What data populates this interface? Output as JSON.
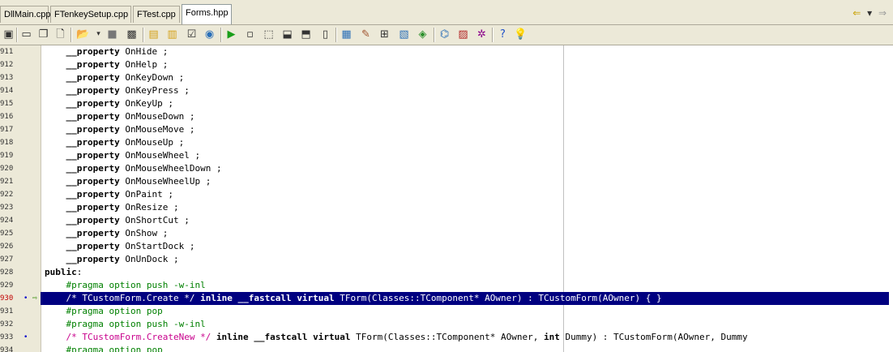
{
  "tabs": [
    {
      "label": "DllMain.cpp",
      "active": false
    },
    {
      "label": "FTenkeySetup.cpp",
      "active": false
    },
    {
      "label": "FTest.cpp",
      "active": false
    },
    {
      "label": "Forms.hpp",
      "active": true
    }
  ],
  "nav": {
    "back_icon": "back-arrow-icon",
    "dropdown_icon": "dropdown-arrow-icon",
    "forward_icon": "forward-arrow-icon"
  },
  "toolbar_icons": [
    "layout-icon",
    "window-icon",
    "copy-window-icon",
    "new-file-icon",
    "open-file-icon",
    "open-dropdown-icon",
    "save-icon",
    "save-all-icon",
    "add-to-project-icon",
    "open-project-icon",
    "remove-from-project-icon",
    "toggle-form-unit-icon",
    "new-form-icon",
    "run-icon",
    "pause-icon",
    "trace-into-icon",
    "step-over-icon",
    "run-to-cursor-icon",
    "program-reset-icon",
    "component-icon",
    "edit-icon",
    "package-icon",
    "object-inspector-icon",
    "database-icon",
    "remote-icon",
    "debug-windows-icon",
    "cpu-icon",
    "help-icon",
    "tip-icon"
  ],
  "colors": {
    "highlight": "#000080",
    "keyword": "#000000",
    "directive": "#008000",
    "comment": "#c8008c",
    "gutter": "#ece9d8"
  },
  "lines": [
    {
      "num": "911",
      "text": "    __property OnHide ;",
      "dot": false,
      "arrow": false,
      "highlight": false
    },
    {
      "num": "912",
      "text": "    __property OnHelp ;",
      "dot": false,
      "arrow": false,
      "highlight": false
    },
    {
      "num": "913",
      "text": "    __property OnKeyDown ;",
      "dot": false,
      "arrow": false,
      "highlight": false
    },
    {
      "num": "914",
      "text": "    __property OnKeyPress ;",
      "dot": false,
      "arrow": false,
      "highlight": false
    },
    {
      "num": "915",
      "text": "    __property OnKeyUp ;",
      "dot": false,
      "arrow": false,
      "highlight": false
    },
    {
      "num": "916",
      "text": "    __property OnMouseDown ;",
      "dot": false,
      "arrow": false,
      "highlight": false
    },
    {
      "num": "917",
      "text": "    __property OnMouseMove ;",
      "dot": false,
      "arrow": false,
      "highlight": false
    },
    {
      "num": "918",
      "text": "    __property OnMouseUp ;",
      "dot": false,
      "arrow": false,
      "highlight": false
    },
    {
      "num": "919",
      "text": "    __property OnMouseWheel ;",
      "dot": false,
      "arrow": false,
      "highlight": false
    },
    {
      "num": "920",
      "text": "    __property OnMouseWheelDown ;",
      "dot": false,
      "arrow": false,
      "highlight": false
    },
    {
      "num": "921",
      "text": "    __property OnMouseWheelUp ;",
      "dot": false,
      "arrow": false,
      "highlight": false
    },
    {
      "num": "922",
      "text": "    __property OnPaint ;",
      "dot": false,
      "arrow": false,
      "highlight": false
    },
    {
      "num": "923",
      "text": "    __property OnResize ;",
      "dot": false,
      "arrow": false,
      "highlight": false
    },
    {
      "num": "924",
      "text": "    __property OnShortCut ;",
      "dot": false,
      "arrow": false,
      "highlight": false
    },
    {
      "num": "925",
      "text": "    __property OnShow ;",
      "dot": false,
      "arrow": false,
      "highlight": false
    },
    {
      "num": "926",
      "text": "    __property OnStartDock ;",
      "dot": false,
      "arrow": false,
      "highlight": false
    },
    {
      "num": "927",
      "text": "    __property OnUnDock ;",
      "dot": false,
      "arrow": false,
      "highlight": false
    },
    {
      "num": "928",
      "text": "public:",
      "dot": false,
      "arrow": false,
      "highlight": false
    },
    {
      "num": "929",
      "text": "    #pragma option push -w-inl",
      "dot": false,
      "arrow": false,
      "highlight": false
    },
    {
      "num": "930",
      "text": "    /* TCustomForm.Create */ inline __fastcall virtual TForm(Classes::TComponent* AOwner) : TCustomForm(AOwner) { }",
      "dot": true,
      "arrow": true,
      "highlight": true
    },
    {
      "num": "931",
      "text": "    #pragma option pop",
      "dot": false,
      "arrow": false,
      "highlight": false
    },
    {
      "num": "932",
      "text": "    #pragma option push -w-inl",
      "dot": false,
      "arrow": false,
      "highlight": false
    },
    {
      "num": "933",
      "text": "    /* TCustomForm.CreateNew */ inline __fastcall virtual TForm(Classes::TComponent* AOwner, int Dummy) : TCustomForm(AOwner, Dummy",
      "dot": true,
      "arrow": false,
      "highlight": false
    },
    {
      "num": "934",
      "text": "    #pragma option pop",
      "dot": false,
      "arrow": false,
      "highlight": false
    }
  ]
}
